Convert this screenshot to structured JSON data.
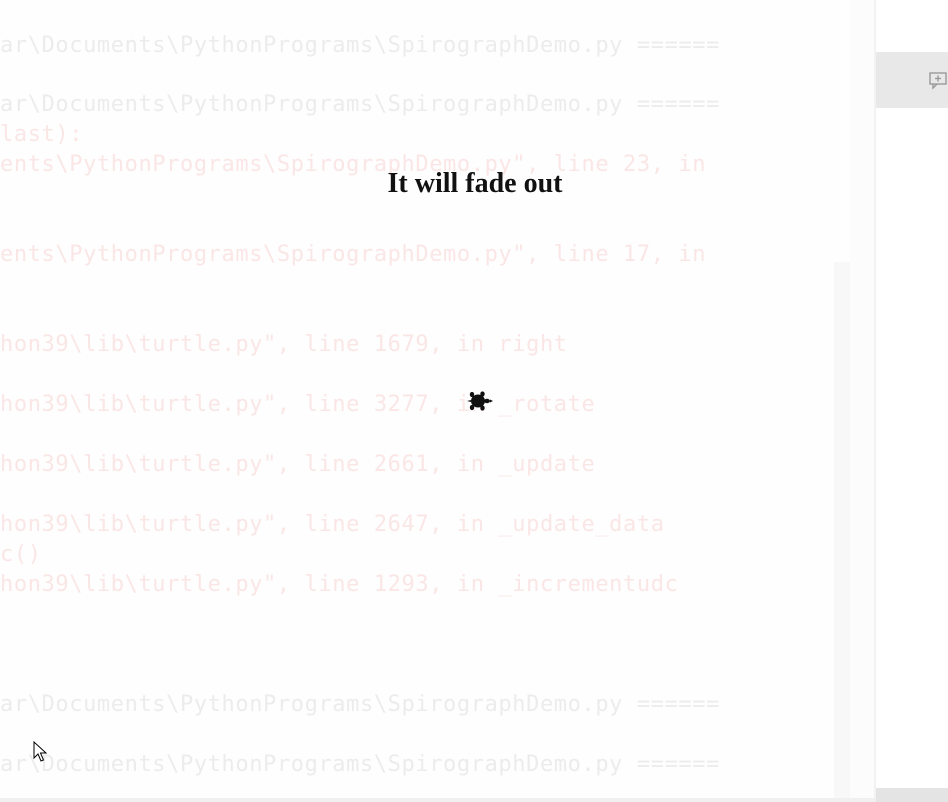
{
  "shell": {
    "lines": [
      {
        "text": "ar\\Documents\\PythonPrograms\\SpirographDemo.py ======",
        "tone": "gray"
      },
      {
        "text": "ar\\Documents\\PythonPrograms\\SpirographDemo.py ======",
        "tone": "gray"
      },
      {
        "text": "last):",
        "tone": "red"
      },
      {
        "text": "ents\\PythonPrograms\\SpirographDemo.py\", line 23, in",
        "tone": "red"
      },
      {
        "text": "ents\\PythonPrograms\\SpirographDemo.py\", line 17, in",
        "tone": "red"
      },
      {
        "text": "hon39\\lib\\turtle.py\", line 1679, in right",
        "tone": "red"
      },
      {
        "text": "hon39\\lib\\turtle.py\", line 3277, in _rotate",
        "tone": "red"
      },
      {
        "text": "hon39\\lib\\turtle.py\", line 2661, in _update",
        "tone": "red"
      },
      {
        "text": "hon39\\lib\\turtle.py\", line 2647, in _update_data",
        "tone": "red"
      },
      {
        "text": "c()",
        "tone": "red"
      },
      {
        "text": "hon39\\lib\\turtle.py\", line 1293, in _incrementudc",
        "tone": "red"
      },
      {
        "text": "ar\\Documents\\PythonPrograms\\SpirographDemo.py ======",
        "tone": "gray"
      },
      {
        "text": "ar\\Documents\\PythonPrograms\\SpirographDemo.py ======",
        "tone": "gray"
      }
    ]
  },
  "canvas": {
    "message": "It will fade out"
  },
  "icons": {
    "turtle": "turtle-icon",
    "cursor": "mouse-pointer-icon",
    "toolbar": "add-panel-icon"
  },
  "colors": {
    "message": "#111111",
    "turtle": "#111111",
    "shell_gray_text": "#ececec",
    "shell_red_text": "#fbe6e6",
    "toolbar_bg": "#e8e8e8"
  }
}
